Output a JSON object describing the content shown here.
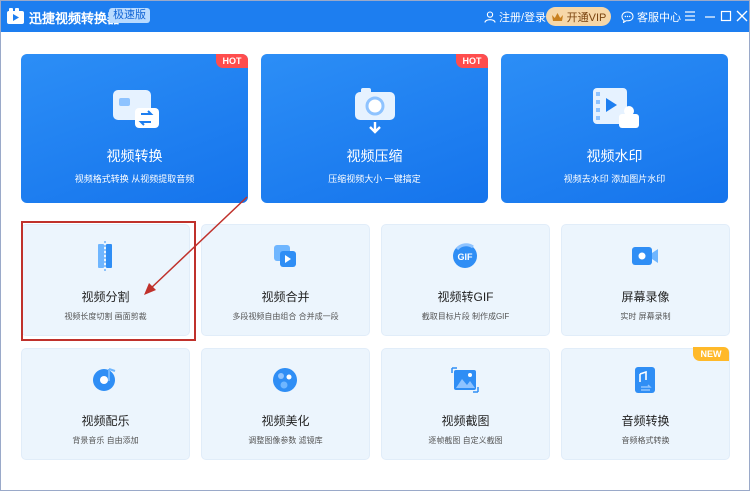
{
  "titlebar": {
    "app_title": "迅捷视频转换器",
    "edition": "极速版",
    "login_label": "注册/登录",
    "vip_label": "开通VIP",
    "service_label": "客服中心"
  },
  "colors": {
    "titlebar": "#1d7ef0",
    "big_card": "#1d81f0",
    "small_card": "#ecf5fd",
    "hot_badge": "#ff4d4d",
    "new_badge": "#ffb929",
    "highlight": "#c0312b"
  },
  "big_cards": [
    {
      "title": "视频转换",
      "subtitle": "视频格式转换 从视频提取音频",
      "badge": "HOT",
      "icon": "video-convert-icon"
    },
    {
      "title": "视频压缩",
      "subtitle": "压缩视频大小 一键搞定",
      "badge": "HOT",
      "icon": "video-compress-icon"
    },
    {
      "title": "视频水印",
      "subtitle": "视频去水印 添加图片水印",
      "badge": "",
      "icon": "video-watermark-icon"
    }
  ],
  "small_cards": [
    {
      "title": "视频分割",
      "subtitle": "视频长度切割 画面剪裁",
      "icon": "video-split-icon"
    },
    {
      "title": "视频合并",
      "subtitle": "多段视频自由组合 合并成一段",
      "icon": "video-merge-icon"
    },
    {
      "title": "视频转GIF",
      "subtitle": "截取目标片段 制作成GIF",
      "icon": "gif-icon"
    },
    {
      "title": "屏幕录像",
      "subtitle": "实时 屏幕录制",
      "icon": "screen-record-icon"
    },
    {
      "title": "视频配乐",
      "subtitle": "背景音乐 自由添加",
      "icon": "music-icon"
    },
    {
      "title": "视频美化",
      "subtitle": "调整图像参数 滤镜库",
      "icon": "beautify-icon"
    },
    {
      "title": "视频截图",
      "subtitle": "逐帧截图 自定义截图",
      "icon": "screenshot-icon"
    },
    {
      "title": "音频转换",
      "subtitle": "音频格式转换",
      "badge": "NEW",
      "icon": "audio-convert-icon"
    }
  ]
}
